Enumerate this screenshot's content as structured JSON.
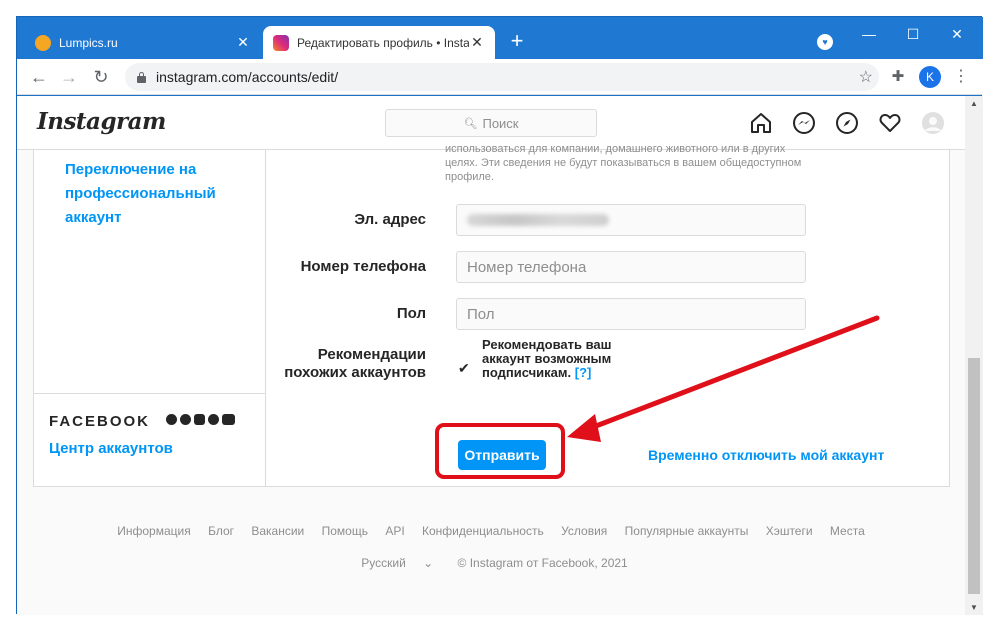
{
  "browser": {
    "tabs": [
      {
        "title": "Lumpics.ru",
        "favicon_color": "#f5a623"
      },
      {
        "title": "Редактировать профиль • Insta",
        "favicon_color": "#e1306c"
      }
    ],
    "url": "instagram.com/accounts/edit/",
    "profile_initial": "K",
    "profile_badge": "♥"
  },
  "ig": {
    "logo": "Instagram",
    "search_placeholder": "Поиск",
    "sidebar": {
      "professional_link": "Переключение на профессиональный аккаунт",
      "facebook_label": "FACEBOOK",
      "accounts_center": "Центр аккаунтов"
    },
    "form": {
      "hint": "использоваться для компании, домашнего животного или в других целях. Эти сведения не будут показываться в вашем общедоступном профиле.",
      "email_label": "Эл. адрес",
      "phone_label": "Номер телефона",
      "phone_placeholder": "Номер телефона",
      "gender_label": "Пол",
      "gender_placeholder": "Пол",
      "recommend_label": "Рекомендации похожих аккаунтов",
      "recommend_text": "Рекомендовать ваш аккаунт возможным подписчикам.",
      "recommend_help": "[?]",
      "recommend_checked": true,
      "submit": "Отправить",
      "disable": "Временно отключить мой аккаунт"
    },
    "footer": {
      "links": [
        "Информация",
        "Блог",
        "Вакансии",
        "Помощь",
        "API",
        "Конфиденциальность",
        "Условия",
        "Популярные аккаунты",
        "Хэштеги",
        "Места"
      ],
      "language": "Русский",
      "copyright": "© Instagram от Facebook, 2021"
    }
  },
  "annotation_color": "#e0101a"
}
